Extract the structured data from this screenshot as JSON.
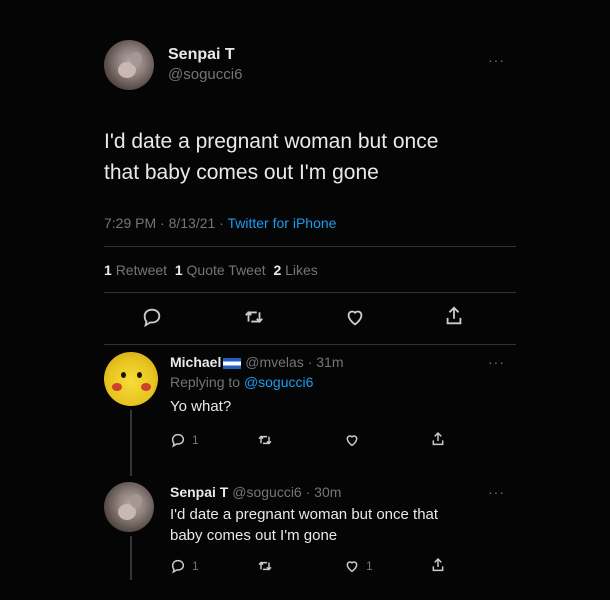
{
  "main_tweet": {
    "author_name": "Senpai T",
    "author_handle": "@sogucci6",
    "text_line1": "I'd date a pregnant woman but once",
    "text_line2": "that baby comes out I'm gone",
    "timestamp": "7:29 PM · 8/13/21 · ",
    "source": "Twitter for iPhone",
    "stats": {
      "retweets_count": "1",
      "retweets_label": "Retweet",
      "quotes_count": "1",
      "quotes_label": "Quote Tweet",
      "likes_count": "2",
      "likes_label": "Likes"
    },
    "icons": [
      "reply-icon",
      "retweet-icon",
      "like-icon",
      "share-icon"
    ]
  },
  "reply1": {
    "author_name": "Michael",
    "author_handle": "@mvelas",
    "time": "· 31m",
    "replying_prefix": "Replying to ",
    "replying_handle": "@sogucci6",
    "text": "Yo what?",
    "reply_count": "1",
    "retweet_count": "",
    "like_count": ""
  },
  "reply2": {
    "author_name": "Senpai T",
    "author_handle": "@sogucci6",
    "time": "· 30m",
    "text_line1": "I'd date a pregnant woman but once that",
    "text_line2": "baby comes out I'm gone",
    "reply_count": "1",
    "retweet_count": "",
    "like_count": "1"
  },
  "more_label": "···",
  "colors": {
    "background": "#000000",
    "text": "#e7e9ea",
    "muted": "#71767b",
    "accent": "#1d9bf0",
    "divider": "#2f3336"
  }
}
